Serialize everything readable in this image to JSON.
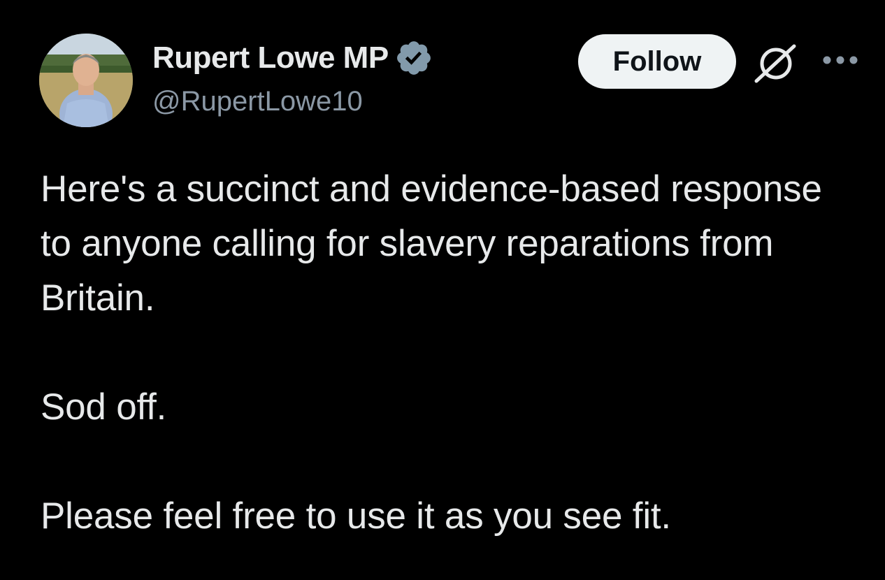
{
  "author": {
    "display_name": "Rupert Lowe MP",
    "handle": "@RupertLowe10",
    "verified": true,
    "verified_color": "#829aab"
  },
  "actions": {
    "follow_label": "Follow",
    "grok_icon": "grok-icon",
    "more_icon": "more-horizontal-icon"
  },
  "tweet": {
    "paragraphs": [
      "Here's a succinct and evidence-based response to anyone calling for slavery reparations from Britain.",
      "Sod off.",
      "Please feel free to use it as you see fit."
    ]
  },
  "theme": {
    "background": "#000000",
    "text": "#e7e9ea",
    "secondary_text": "#8b98a5",
    "follow_bg": "#eff3f4"
  }
}
